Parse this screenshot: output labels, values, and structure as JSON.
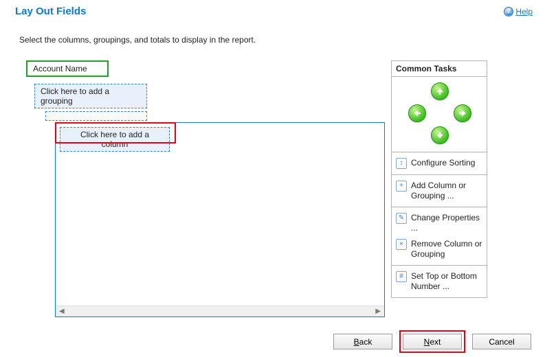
{
  "header": {
    "title": "Lay Out Fields",
    "help_label": "Help"
  },
  "instruction": "Select the columns, groupings, and totals to display in the report.",
  "fields": {
    "account_name": "Account Name",
    "add_grouping": "Click here to add a grouping",
    "add_column": "Click here to add a column"
  },
  "common_tasks": {
    "header": "Common Tasks",
    "configure_sorting": "Configure Sorting",
    "add_column_grouping": "Add Column or Grouping ...",
    "change_properties": "Change Properties ...",
    "remove_column_grouping": "Remove Column or Grouping",
    "set_top_bottom": "Set Top or Bottom Number ..."
  },
  "footer": {
    "back": "Back",
    "next": "Next",
    "cancel": "Cancel"
  },
  "colors": {
    "accent": "#0a7bd1",
    "highlight": "#e2001a",
    "ok_green": "#1aa520"
  }
}
